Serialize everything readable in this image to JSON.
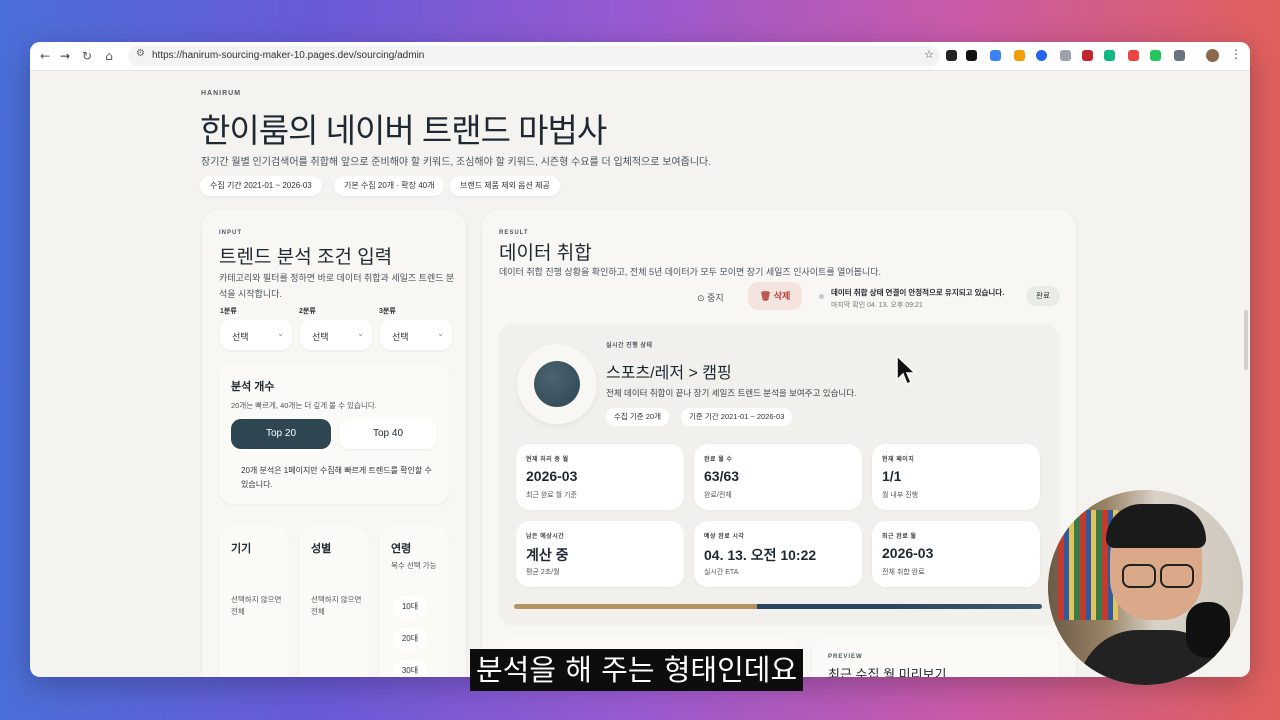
{
  "browser": {
    "url": "https://hanirum-sourcing-maker-10.pages.dev/sourcing/admin"
  },
  "header": {
    "brand": "HANIRUM",
    "title": "한이룸의 네이버 트랜드 마법사",
    "subtitle": "장기간 월별 인기검색어를 취합해 앞으로 준비해야 할 키워드, 조심해야 할 키워드, 시즌형 수요를 더 입체적으로 보여줍니다.",
    "chips": [
      "수집 기간 2021-01 ~ 2026-03",
      "기본 수집 20개 · 확장 40개",
      "브랜드 제품 제외 옵션 제공"
    ]
  },
  "input_panel": {
    "tag": "INPUT",
    "title": "트렌드 분석 조건 입력",
    "description": "카테고리와 필터를 정하면 바로 데이터 취합과 세일즈 트렌드 분석을 시작합니다.",
    "categories": [
      {
        "label": "1분류",
        "value": "선택"
      },
      {
        "label": "2분류",
        "value": "선택"
      },
      {
        "label": "3분류",
        "value": "선택"
      }
    ],
    "analysis_count": {
      "title": "분석 개수",
      "description": "20개는 빠르게, 40개는 더 깊게 볼 수 있습니다.",
      "option_top20": "Top 20",
      "option_top40": "Top 40",
      "note": "20개 분석은 1페이지만 수집해 빠르게 트렌드를 확인할 수 있습니다."
    },
    "filters": {
      "device_title": "기기",
      "device_desc": "선택하지 않으면 전체",
      "gender_title": "성별",
      "gender_desc": "선택하지 않으면 전체",
      "age_title": "연령",
      "age_desc": "복수 선택 가능",
      "ages": [
        "10대",
        "20대",
        "30대"
      ]
    }
  },
  "result_panel": {
    "tag": "RESULT",
    "title": "데이터 취합",
    "description": "데이터 취합 진행 상황을 확인하고, 전체 5년 데이터가 모두 모이면 장기 세일즈 인사이트를 열어봅니다.",
    "stop_label": "중지",
    "delete_label": "삭제",
    "status_title": "데이터 취합 상태 연결이 안정적으로 유지되고 있습니다.",
    "status_sub": "마지막 확인 04. 13. 오후 09:21",
    "done_label": "완료",
    "live": {
      "tag": "실시간 진행 상태",
      "category": "스포츠/레저 > 캠핑",
      "description": "전체 데이터 취합이 끝나 장기 세일즈 트렌드 분석을 보여주고 있습니다.",
      "pills": [
        "수집 기준 20개",
        "기준 기간 2021-01 ~ 2026-03"
      ],
      "progress": 1.0
    },
    "stats": [
      {
        "key": "현재 처리 중 월",
        "value": "2026-03",
        "sub": "최근 완료 월 기준"
      },
      {
        "key": "완료 월 수",
        "value": "63/63",
        "sub": "완료/전체"
      },
      {
        "key": "현재 페이지",
        "value": "1/1",
        "sub": "월 내부 진행"
      },
      {
        "key": "남은 예상시간",
        "value": "계산 중",
        "sub": "평균 2초/월"
      },
      {
        "key": "예상 완료 시각",
        "value": "04. 13. 오전 10:22",
        "sub": "실시간 ETA"
      },
      {
        "key": "최근 완료 월",
        "value": "2026-03",
        "sub": "전체 취합 완료"
      }
    ],
    "preview_tag": "PREVIEW",
    "preview_title": "최근 수집 월 미리보기"
  },
  "caption": "분석을 해 주는 형태인데요",
  "colors": {
    "accent_dark": "#2e4652",
    "progress_gold": "#b39463",
    "progress_navy": "#2b4560",
    "delete_bg": "#f5e4de"
  }
}
